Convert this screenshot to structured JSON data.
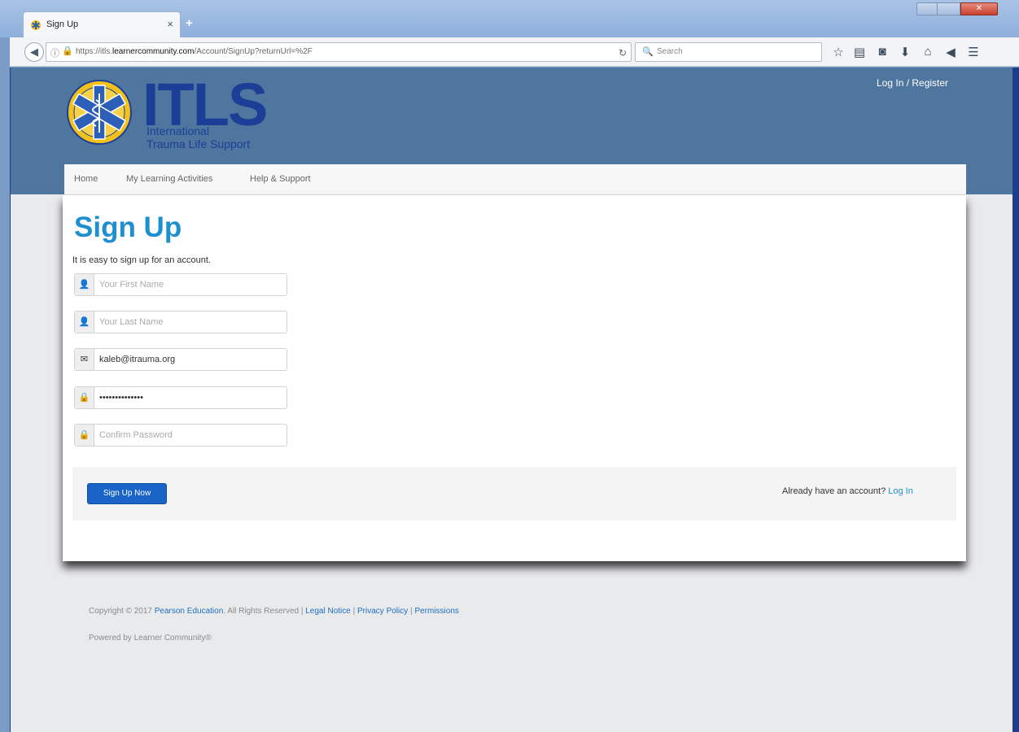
{
  "browser": {
    "tab_title": "Sign Up",
    "tab_close": "×",
    "new_tab": "+",
    "url_prefix": "https://itls.",
    "url_host": "learnercommunity.com",
    "url_path": "/Account/SignUp?returnUrl=%2F",
    "search_placeholder": "Search"
  },
  "header": {
    "logo_text": "ITLS",
    "logo_line1": "International",
    "logo_line2": "Trauma Life Support",
    "login_register": "Log In / Register",
    "colors": {
      "header_bg": "#4e769e",
      "logo_blue": "#1d3e96",
      "emblem_yellow": "#f2c21b",
      "star_blue": "#2b5fb8"
    }
  },
  "menu": {
    "items": [
      "Home",
      "My Learning Activities",
      "Help & Support"
    ]
  },
  "signup": {
    "title": "Sign Up",
    "intro": "It is easy to sign up for an account.",
    "fields": {
      "first_name": {
        "placeholder": "Your First Name",
        "value": ""
      },
      "last_name": {
        "placeholder": "Your Last Name",
        "value": ""
      },
      "email": {
        "placeholder": "",
        "value": "kaleb@itrauma.org"
      },
      "password": {
        "placeholder": "",
        "value": "••••••••••••••"
      },
      "confirm_password": {
        "placeholder": "Confirm Password",
        "value": ""
      }
    },
    "submit_label": "Sign Up Now",
    "already_text": "Already have an account?",
    "login_link": "Log In",
    "colors": {
      "title": "#1e8fcf",
      "button": "#1a63c7"
    }
  },
  "footer": {
    "copyright": "Copyright © 2017",
    "company": "Pearson Education",
    "rights": ". All Rights Reserved |",
    "legal": "Legal Notice",
    "privacy": "Privacy Policy",
    "permissions": "Permissions",
    "sep": "|",
    "powered": "Powered by Learner Community®"
  }
}
